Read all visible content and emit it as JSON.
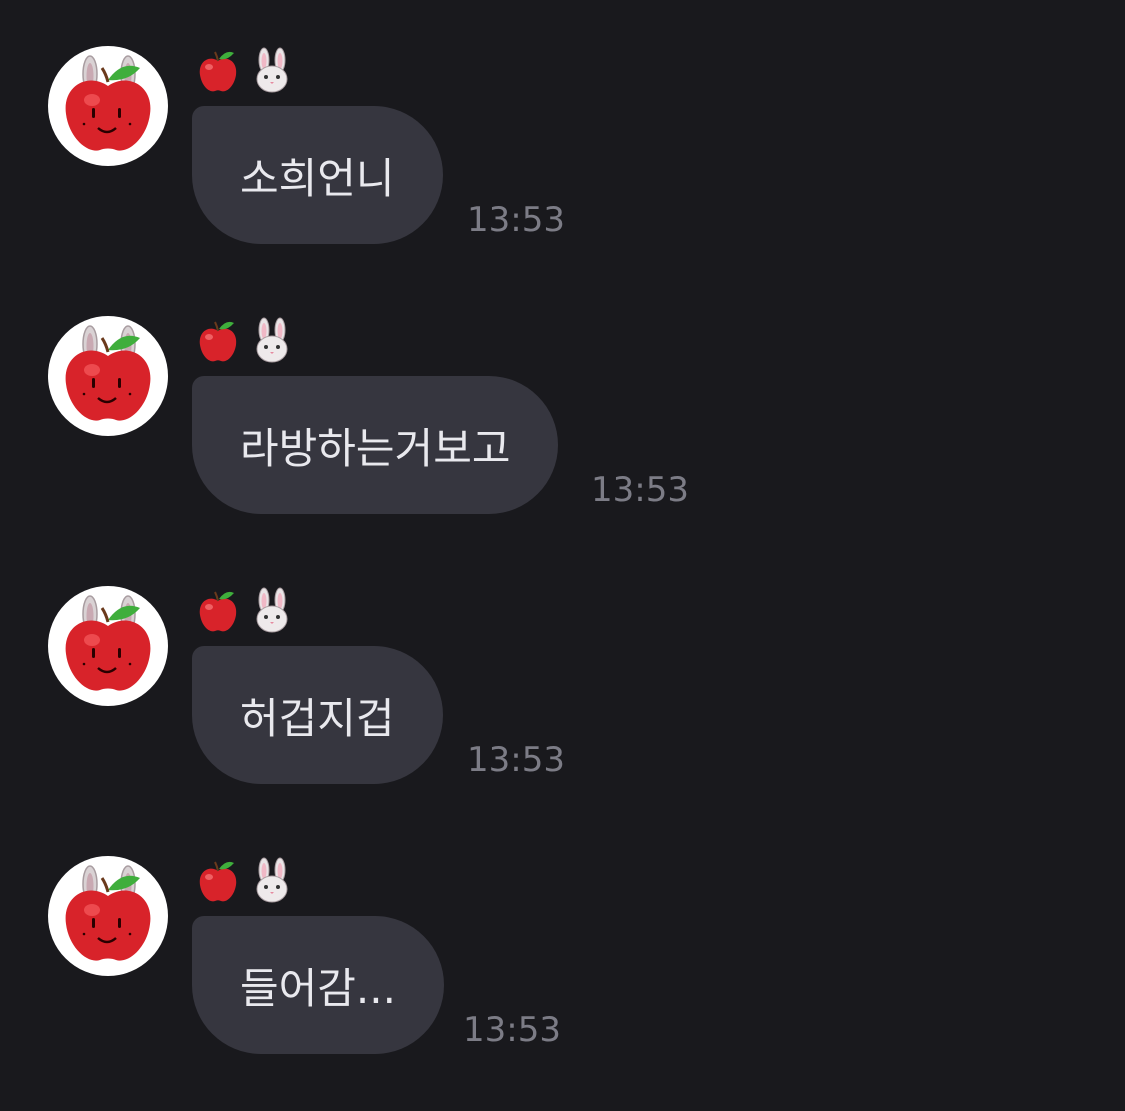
{
  "colors": {
    "background": "#19191d",
    "bubble": "#36363f",
    "bubble_text": "#e9e9ee",
    "timestamp": "#7c7c86"
  },
  "messages": [
    {
      "sender": "🍎🐰",
      "avatar_icon": "apple-bunny-icon",
      "text": "소희언니",
      "time": "13:53"
    },
    {
      "sender": "🍎🐰",
      "avatar_icon": "apple-bunny-icon",
      "text": "라방하는거보고",
      "time": "13:53"
    },
    {
      "sender": "🍎🐰",
      "avatar_icon": "apple-bunny-icon",
      "text": "허겁지겁",
      "time": "13:53"
    },
    {
      "sender": "🍎🐰",
      "avatar_icon": "apple-bunny-icon",
      "text": "들어감...",
      "time": "13:53"
    }
  ]
}
